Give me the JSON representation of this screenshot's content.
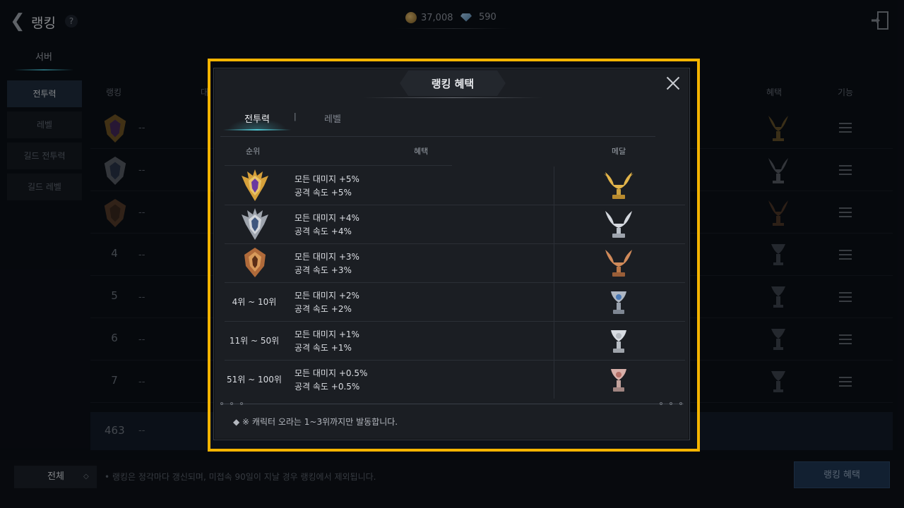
{
  "header": {
    "back_icon": "chevron-left-icon",
    "title": "랭킹",
    "help_label": "?",
    "gold_amount": "37,008",
    "gem_amount": "590"
  },
  "tabs": {
    "server": "서버"
  },
  "sidebar": {
    "items": [
      {
        "label": "전투력",
        "active": true
      },
      {
        "label": "레벨"
      },
      {
        "label": "길드 전투력"
      },
      {
        "label": "길드 레벨"
      }
    ]
  },
  "list_headers": {
    "rank": "랭킹",
    "name": "대",
    "benefit": "혜택",
    "function": "기능"
  },
  "ranking_rows": [
    {
      "rank": "",
      "name": "--"
    },
    {
      "rank": "",
      "name": "--"
    },
    {
      "rank": "",
      "name": "--"
    },
    {
      "rank": "4",
      "name": "--"
    },
    {
      "rank": "5",
      "name": "--"
    },
    {
      "rank": "6",
      "name": "--"
    },
    {
      "rank": "7",
      "name": "--"
    }
  ],
  "my_rank": {
    "rank": "463",
    "name": "--"
  },
  "footer": {
    "filter_label": "전체",
    "filter_caret": "◇",
    "notice": "• 랭킹은 정각마다 갱신되며, 미접속 90일이 지날 경우 랭킹에서 제외됩니다.",
    "benefit_button": "랭킹 혜택"
  },
  "popup": {
    "title": "랭킹 혜택",
    "tabs": [
      {
        "label": "전투력",
        "active": true
      },
      {
        "label": "레벨"
      }
    ],
    "columns": {
      "rank": "순위",
      "benefit": "혜택",
      "medal": "메달"
    },
    "rows": [
      {
        "rank": "",
        "benefit1": "모든 대미지 +5%",
        "benefit2": "공격 속도 +5%"
      },
      {
        "rank": "",
        "benefit1": "모든 대미지 +4%",
        "benefit2": "공격 속도 +4%"
      },
      {
        "rank": "",
        "benefit1": "모든 대미지 +3%",
        "benefit2": "공격 속도 +3%"
      },
      {
        "rank": "4위 ~ 10위",
        "benefit1": "모든 대미지 +2%",
        "benefit2": "공격 속도 +2%"
      },
      {
        "rank": "11위 ~ 50위",
        "benefit1": "모든 대미지 +1%",
        "benefit2": "공격 속도 +1%"
      },
      {
        "rank": "51위 ~ 100위",
        "benefit1": "모든 대미지 +0.5%",
        "benefit2": "공격 속도 +0.5%"
      }
    ],
    "note": "◆  ※ 캐릭터 오라는 1~3위까지만 발동합니다."
  },
  "colors": {
    "gold": "#d8a93a",
    "silver": "#c9ced6",
    "bronze": "#b8774a",
    "accent": "#4ec3cf",
    "highlight": "#f4b400"
  }
}
